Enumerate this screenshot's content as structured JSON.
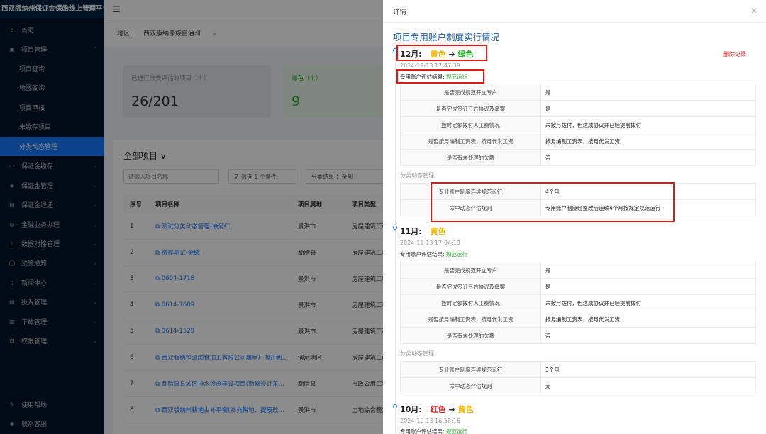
{
  "app": {
    "title": "西双版纳州保证金保函线上管理平台"
  },
  "sidebar": {
    "items": [
      {
        "label": "首页",
        "icon": "home-icon"
      },
      {
        "label": "项目管理",
        "icon": "project-icon",
        "arrow": "^"
      },
      {
        "label": "项目查询"
      },
      {
        "label": "地图查询"
      },
      {
        "label": "项目审核"
      },
      {
        "label": "未缴存项目"
      },
      {
        "label": "分类动态管理"
      },
      {
        "label": "保证金缴存",
        "icon": "deposit-icon"
      },
      {
        "label": "保证金管理",
        "icon": "shield-icon"
      },
      {
        "label": "保证金退还",
        "icon": "refund-icon"
      },
      {
        "label": "金融业务办理",
        "icon": "finance-icon"
      },
      {
        "label": "数据对接管理",
        "icon": "data-icon"
      },
      {
        "label": "预警通知",
        "icon": "bell-icon"
      },
      {
        "label": "新闻中心",
        "icon": "news-icon"
      },
      {
        "label": "投诉管理",
        "icon": "complaint-icon"
      },
      {
        "label": "下载管理",
        "icon": "download-icon"
      },
      {
        "label": "权限管理",
        "icon": "lock-icon"
      },
      {
        "label": "使用帮助",
        "icon": "help-icon"
      },
      {
        "label": "联系客服",
        "icon": "service-icon"
      }
    ]
  },
  "main": {
    "region_label": "地区:",
    "region_value": "西双版纳傣族自治州",
    "cards": [
      {
        "label": "已进行分类评估的项目（个）",
        "value": "26/201"
      },
      {
        "label": "绿色（个）",
        "value": "9"
      }
    ],
    "panel": {
      "title": "全部项目 ∨",
      "search_placeholder": "请输入项目名称",
      "filter_label": "筛选 1 个条件",
      "result_label": "分类结果 ：全部"
    },
    "columns": [
      "序号",
      "项目名称",
      "项目属地",
      "项目类型"
    ],
    "rows": [
      [
        "1",
        "测试分类动态管理-徐爱红",
        "景洪市",
        "房屋建筑工程"
      ],
      [
        "2",
        "缴存测试-免缴",
        "勐腊县",
        "房屋建筑工程"
      ],
      [
        "3",
        "0604-1718",
        "景洪市",
        "房屋建筑工程"
      ],
      [
        "4",
        "0614-1609",
        "景洪市",
        "房屋建筑工程"
      ],
      [
        "5",
        "0614-1528",
        "景洪市",
        "房屋建筑工程"
      ],
      [
        "6",
        "西双版纳恒源肉食加工有限公司屠宰厂搬迁新...",
        "演示地区",
        "房屋建筑工程"
      ],
      [
        "7",
        "勐腊县县城区排水设施建设项目(勘察设计采...",
        "勐腊县",
        "市政公用工程"
      ],
      [
        "8",
        "西双版纳州耕地占补平衡(补充耕地、提质改...",
        "景洪市",
        "土地综合整治"
      ]
    ]
  },
  "drawer": {
    "header": "详情",
    "close": "×",
    "title": "项目专用账户制度实行情况",
    "delete_label": "删除记录",
    "records": [
      {
        "month": "12月:",
        "from": "黄色",
        "arrow": "➜",
        "to": "绿色",
        "time": "2024-12-13 17:47:39",
        "eval_label": "专用账户评估结果:",
        "eval_value": "规范运行",
        "rows": [
          [
            "是否完成规范开立专户",
            "是"
          ],
          [
            "是否完成签订三方协议及备案",
            "是"
          ],
          [
            "按时足额拨付人工费情况",
            "未按月拨付，但达成协议并已经提前拨付"
          ],
          [
            "是否按月编制工资表，按月代发工资",
            "按月编制工资表，按月代发工资"
          ],
          [
            "是否有未处理的欠薪",
            "否"
          ]
        ],
        "section": "分类动态管理",
        "dyn_rows": [
          [
            "专业账户制度连续规范运行",
            "4个月"
          ],
          [
            "命中动态评估规则",
            "专用账户制度经整改后连续4个月按规定规范运行"
          ]
        ]
      },
      {
        "month": "11月:",
        "to": "黄色",
        "time": "2024-11-13 17:04:19",
        "eval_label": "专用账户评估结果:",
        "eval_value": "规范运行",
        "rows": [
          [
            "是否完成规范开立专户",
            "是"
          ],
          [
            "是否完成签订三方协议及备案",
            "是"
          ],
          [
            "按时足额拨付人工费情况",
            "未按月拨付，但达成协议并已经提前拨付"
          ],
          [
            "是否按月编制工资表，按月代发工资",
            "按月编制工资表，按月代发工资"
          ],
          [
            "是否有未处理的欠薪",
            "否"
          ]
        ],
        "section": "分类动态管理",
        "dyn_rows": [
          [
            "专业账户制度连续规范运行",
            "3个月"
          ],
          [
            "命中动态评估规则",
            "无"
          ]
        ]
      },
      {
        "month": "10月:",
        "from": "红色",
        "arrow": "➜",
        "to": "黄色",
        "time": "2024-10-13 16:58:16",
        "eval_label": "专用账户评估结果:",
        "eval_value": "规范运行"
      }
    ]
  },
  "colors": {
    "accent": "#1677ff",
    "sidebar_bg": "#001529",
    "highlight": "#e01818",
    "green": "#27ae2a",
    "yellow": "#f2b705",
    "red": "#e02020"
  }
}
